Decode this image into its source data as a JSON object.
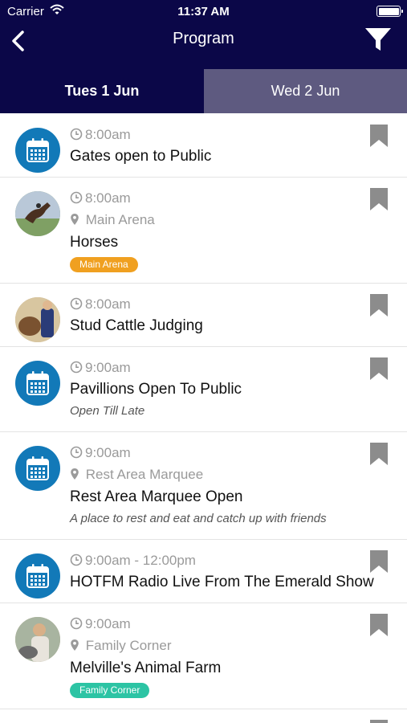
{
  "status_bar": {
    "carrier": "Carrier",
    "time": "11:37 AM"
  },
  "nav": {
    "title": "Program",
    "back_icon": "chevron-left-icon",
    "filter_icon": "filter-icon"
  },
  "tabs": [
    {
      "label": "Tues 1 Jun",
      "selected": true
    },
    {
      "label": "Wed 2 Jun",
      "selected": false
    }
  ],
  "colors": {
    "header": "#0b0748",
    "tab_inactive": "#5e5a80",
    "calendar_circle": "#1279b8",
    "tag_main_arena": "#f0a020",
    "tag_family_corner": "#2cc4a4"
  },
  "events": [
    {
      "time": "8:00am",
      "title": "Gates open to Public",
      "icon": "calendar-icon"
    },
    {
      "time": "8:00am",
      "location": "Main Arena",
      "title": "Horses",
      "tag": "Main Arena",
      "icon": "horse-photo"
    },
    {
      "time": "8:00am",
      "title": "Stud Cattle Judging",
      "icon": "cattle-photo"
    },
    {
      "time": "9:00am",
      "title": "Pavillions Open To Public",
      "subtitle": "Open Till Late",
      "icon": "calendar-icon"
    },
    {
      "time": "9:00am",
      "location": "Rest Area Marquee",
      "title": "Rest Area Marquee Open",
      "subtitle": "A place to rest and eat and catch up with friends",
      "icon": "calendar-icon"
    },
    {
      "time": "9:00am - 12:00pm",
      "title": "HOTFM Radio Live From The Emerald Show",
      "icon": "calendar-icon"
    },
    {
      "time": "9:00am",
      "location": "Family Corner",
      "title": "Melville's Animal Farm",
      "tag": "Family Corner",
      "icon": "animal-farm-photo"
    }
  ]
}
